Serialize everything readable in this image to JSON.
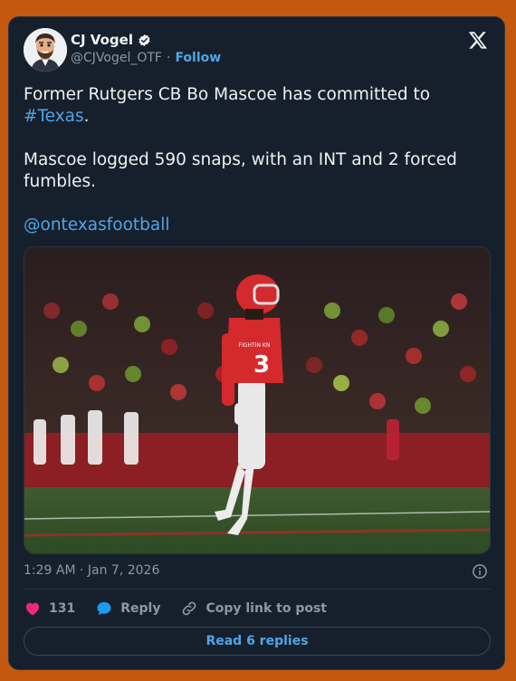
{
  "author": {
    "name": "CJ Vogel",
    "handle": "@CJVogel_OTF",
    "separator": "·",
    "follow_label": "Follow"
  },
  "tweet": {
    "line1": "Former Rutgers CB Bo Mascoe has committed to",
    "hashtag": "#Texas",
    "line1_end": ".",
    "line2": "Mascoe logged 590 snaps, with an INT and 2 forced fumbles.",
    "mention": "@ontexasfootball"
  },
  "timestamp": "1:29 AM · Jan 7, 2026",
  "actions": {
    "likes": "131",
    "reply_label": "Reply",
    "copy_label": "Copy link to post"
  },
  "read_replies_label": "Read 6 replies",
  "photo": {
    "jersey_number": "3",
    "jersey_text": "FIGHTIN KN"
  },
  "colors": {
    "background": "#c4580e",
    "card": "#16202c",
    "accent": "#4fa5e6",
    "heart": "#f0287a",
    "jersey": "#d42a2e"
  },
  "icons": [
    "verified-badge-icon",
    "x-logo-icon",
    "info-icon",
    "heart-icon",
    "reply-bubble-icon",
    "link-icon"
  ]
}
